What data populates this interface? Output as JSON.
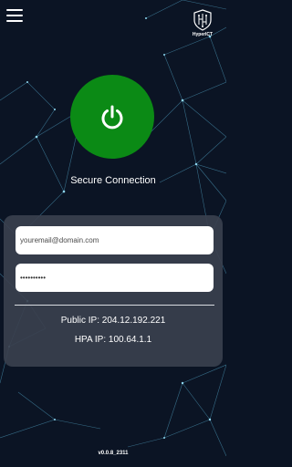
{
  "header": {
    "brand_name": "HyperICT",
    "menu_icon": "hamburger-menu-icon",
    "logo_icon": "shield-circuit-logo"
  },
  "connection": {
    "power_icon": "power-icon",
    "status_title": "Secure Connection",
    "button_color": "#0b8a15"
  },
  "login": {
    "email_placeholder": "youremail@domain.com",
    "email_value": "",
    "password_value": "••••••••••"
  },
  "network": {
    "public_ip_text": "Public IP: 204.12.192.221",
    "hpa_ip_text": "HPA IP: 100.64.1.1"
  },
  "footer": {
    "version": "v0.0.8_2311"
  },
  "colors": {
    "background": "#0b1424",
    "network_lines": "#5ab4d8",
    "panel": "#3a404e"
  }
}
